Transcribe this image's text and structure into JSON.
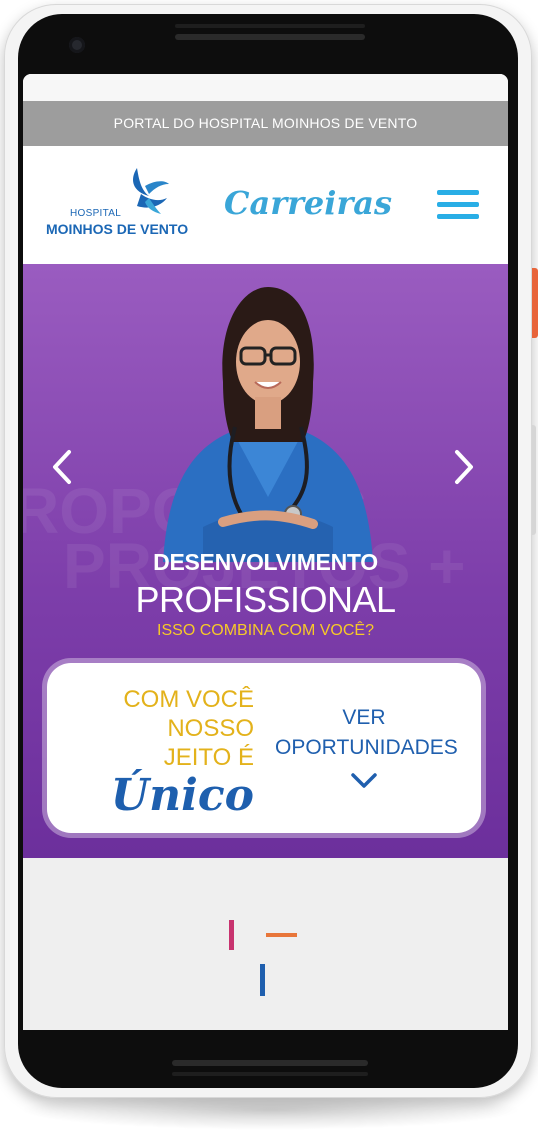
{
  "portal_bar": {
    "text": "PORTAL DO HOSPITAL MOINHOS DE VENTO"
  },
  "header": {
    "logo_small": "HOSPITAL",
    "logo_big": "MOINHOS DE VENTO",
    "careers": "Carreiras",
    "menu_icon": "hamburger-menu-icon"
  },
  "hero": {
    "title_line1": "DESENVOLVIMENTO",
    "title_line2": "PROFISSIONAL",
    "subtitle": "ISSO COMBINA COM VOCÊ?",
    "prev_icon": "chevron-left-icon",
    "next_icon": "chevron-right-icon"
  },
  "cta": {
    "tagline_line1": "COM VOCÊ",
    "tagline_line2": "NOSSO",
    "tagline_line3": "JEITO É",
    "tagline_line4": "Único",
    "button_line1": "VER",
    "button_line2": "OPORTUNIDADES",
    "button_icon": "chevron-down-icon"
  },
  "colors": {
    "portal_bar": "#9d9d9d",
    "brand_blue": "#1b67b5",
    "careers_blue": "#3aa6d8",
    "hero_purple": "#7d3eaa",
    "accent_yellow": "#f7c928",
    "decor_pink": "#c8336f",
    "decor_orange": "#e8763a",
    "decor_blue": "#1f5fae"
  }
}
